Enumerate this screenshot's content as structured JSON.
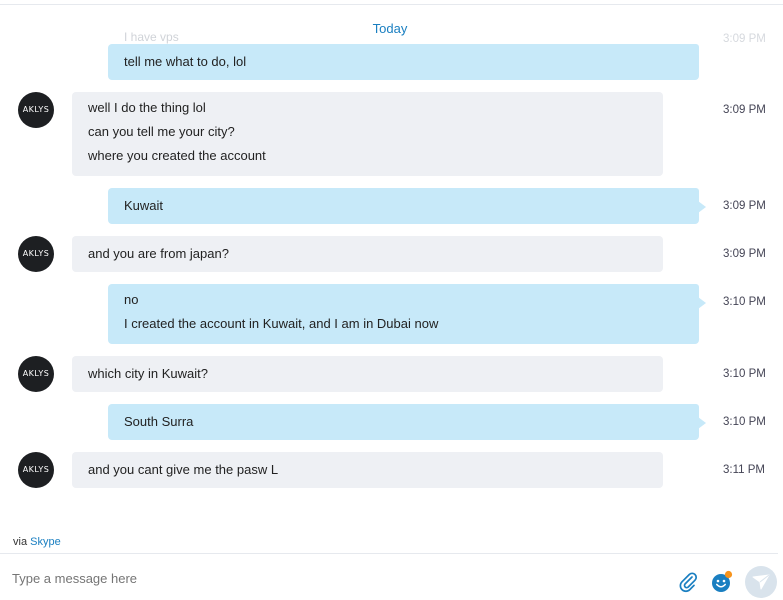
{
  "date_divider": "Today",
  "ghost_text": "I have vps",
  "ghost_time": "3:09 PM",
  "messages": [
    {
      "dir": "out",
      "lines": [
        "tell me what to do, lol"
      ],
      "time": ""
    },
    {
      "dir": "in",
      "avatar": "AKLYS",
      "lines": [
        "well I do the thing lol",
        "can you tell me your city?",
        "where you created the account"
      ],
      "time": "3:09 PM"
    },
    {
      "dir": "out",
      "lines": [
        "Kuwait"
      ],
      "time": "3:09 PM"
    },
    {
      "dir": "in",
      "avatar": "AKLYS",
      "lines": [
        "and you are from japan?"
      ],
      "time": "3:09 PM"
    },
    {
      "dir": "out",
      "lines": [
        "no",
        "I created the account in Kuwait, and I am in Dubai now"
      ],
      "time": "3:10 PM"
    },
    {
      "dir": "in",
      "avatar": "AKLYS",
      "lines": [
        "which city in Kuwait?"
      ],
      "time": "3:10 PM"
    },
    {
      "dir": "out",
      "lines": [
        "South Surra"
      ],
      "time": "3:10 PM"
    },
    {
      "dir": "in",
      "avatar": "AKLYS",
      "lines": [
        "and you cant give me the pasw L"
      ],
      "time": "3:11 PM"
    }
  ],
  "via": {
    "prefix": "via",
    "link": "Skype"
  },
  "composer": {
    "placeholder": "Type a message here",
    "attach_icon": "paperclip-icon",
    "emoji_icon": "emoticon-icon",
    "send_icon": "send-icon"
  },
  "colors": {
    "outgoing_bubble": "#c7e9f9",
    "incoming_bubble": "#eef0f4",
    "accent": "#1a7fc1"
  }
}
